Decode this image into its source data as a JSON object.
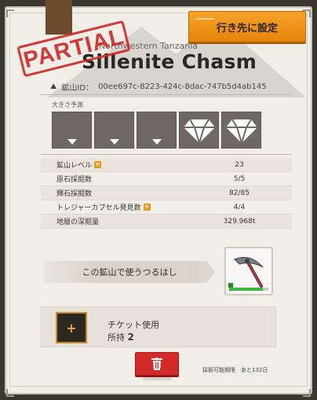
{
  "header": {
    "set_destination_label": "行き先に設定",
    "region": "Northwestern Tanzania",
    "mine_name": "Sillenite Chasm",
    "stamp_text": "PARTIAL",
    "mine_id_label": "鉱山ID：",
    "mine_id_value": "00ee697c-8223-424c-8dac-747b5d4ab145"
  },
  "size_estimate": {
    "label": "大きさ予測",
    "slots": [
      {
        "icon": "gem-icon",
        "size": "small"
      },
      {
        "icon": "gem-icon",
        "size": "small"
      },
      {
        "icon": "gem-icon",
        "size": "small"
      },
      {
        "icon": "gem-icon",
        "size": "large"
      },
      {
        "icon": "gem-icon",
        "size": "large"
      }
    ]
  },
  "stats": [
    {
      "label": "鉱山レベル",
      "value": "23",
      "info": true
    },
    {
      "label": "原石採掘数",
      "value": "5/5",
      "info": false
    },
    {
      "label": "輝石採掘数",
      "value": "82/85",
      "info": false
    },
    {
      "label": "トレジャーカプセル発見数",
      "value": "4/4",
      "info": true
    },
    {
      "label": "地層の深掘量",
      "value": "329.968t",
      "info": false
    }
  ],
  "pickaxe": {
    "banner_label": "この鉱山で使うつるはし",
    "icon": "pickaxe-icon",
    "durability_fraction": 0.85
  },
  "ticket": {
    "add_label": "+",
    "title": "チケット使用",
    "owned_label": "所持",
    "owned_count": "2"
  },
  "footer": {
    "delete_icon": "trash-icon",
    "deadline_text": "採掘可能期限　あと132日"
  },
  "colors": {
    "accent_orange": "#f09a1c",
    "delete_red": "#d42a2a",
    "card_bg": "#f1eee8",
    "stamp_red": "#d02828"
  }
}
